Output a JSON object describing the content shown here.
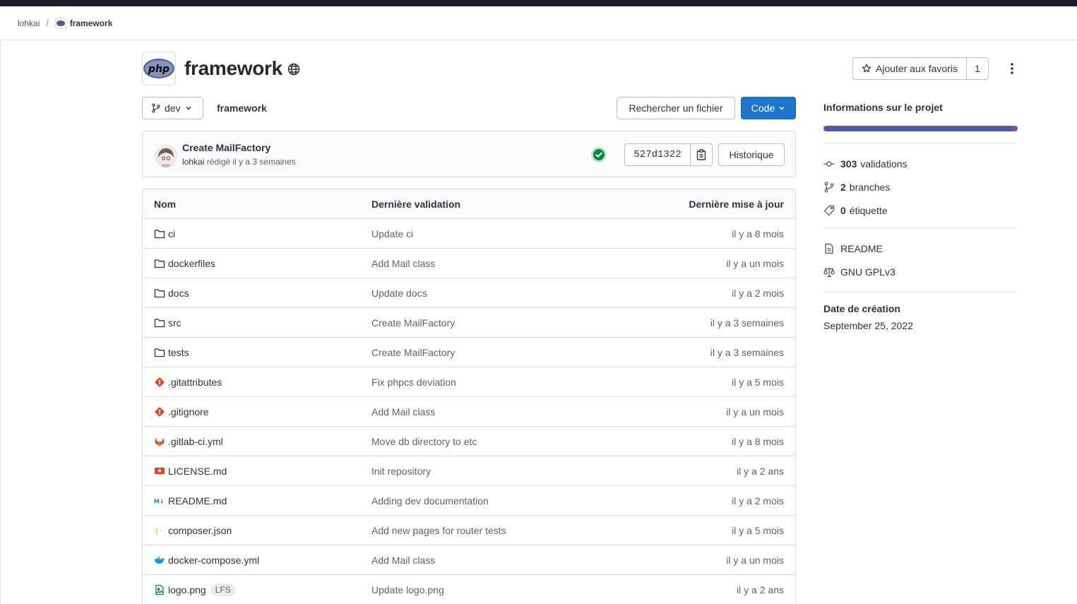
{
  "breadcrumb": {
    "owner": "lohkai",
    "project": "framework"
  },
  "project": {
    "name": "framework",
    "avatar_text": "php",
    "star_label": "Ajouter aux favoris",
    "star_count": "1"
  },
  "toolbar": {
    "branch": "dev",
    "path": "framework",
    "find_file_label": "Rechercher un fichier",
    "code_label": "Code"
  },
  "last_commit": {
    "title": "Create MailFactory",
    "author": "lohkai",
    "meta_text": "rédigé il y a 3 semaines",
    "sha": "527d1322",
    "history_label": "Historique",
    "pipeline_status": "success"
  },
  "table": {
    "headers": {
      "name": "Nom",
      "commit": "Dernière validation",
      "date": "Dernière mise à jour"
    },
    "rows": [
      {
        "name": "ci",
        "icon": "folder-icon",
        "commit": "Update ci",
        "date": "il y a 8 mois"
      },
      {
        "name": "dockerfiles",
        "icon": "folder-icon",
        "commit": "Add Mail class",
        "date": "il y a un mois"
      },
      {
        "name": "docs",
        "icon": "folder-icon",
        "commit": "Update docs",
        "date": "il y a 2 mois"
      },
      {
        "name": "src",
        "icon": "folder-icon",
        "commit": "Create MailFactory",
        "date": "il y a 3 semaines"
      },
      {
        "name": "tests",
        "icon": "folder-icon",
        "commit": "Create MailFactory",
        "date": "il y a 3 semaines"
      },
      {
        "name": ".gitattributes",
        "icon": "git-icon",
        "commit": "Fix phpcs deviation",
        "date": "il y a 5 mois"
      },
      {
        "name": ".gitignore",
        "icon": "git-icon",
        "commit": "Add Mail class",
        "date": "il y a un mois"
      },
      {
        "name": ".gitlab-ci.yml",
        "icon": "gitlab-icon",
        "commit": "Move db directory to etc",
        "date": "il y a 8 mois"
      },
      {
        "name": "LICENSE.md",
        "icon": "license-icon",
        "commit": "Init repository",
        "date": "il y a 2 ans"
      },
      {
        "name": "README.md",
        "icon": "markdown-icon",
        "commit": "Adding dev documentation",
        "date": "il y a 2 mois"
      },
      {
        "name": "composer.json",
        "icon": "json-icon",
        "commit": "Add new pages for router tests",
        "date": "il y a 5 mois"
      },
      {
        "name": "docker-compose.yml",
        "icon": "docker-icon",
        "commit": "Add Mail class",
        "date": "il y a un mois"
      },
      {
        "name": "logo.png",
        "icon": "image-icon",
        "badge": "LFS",
        "commit": "Update logo.png",
        "date": "il y a 2 ans"
      }
    ]
  },
  "sidebar": {
    "title": "Informations sur le projet",
    "commits_count": "303",
    "commits_label": "validations",
    "branches_count": "2",
    "branches_label": "branches",
    "tags_count": "0",
    "tags_label": "étiquette",
    "readme_label": "README",
    "license_label": "GNU GPLv3",
    "created_label": "Date de création",
    "created_date": "September 25, 2022"
  },
  "colors": {
    "accent": "#1f75cb",
    "success": "#108548",
    "language_primary": "#4f5aa3",
    "language_secondary": "#8a4aa4"
  }
}
